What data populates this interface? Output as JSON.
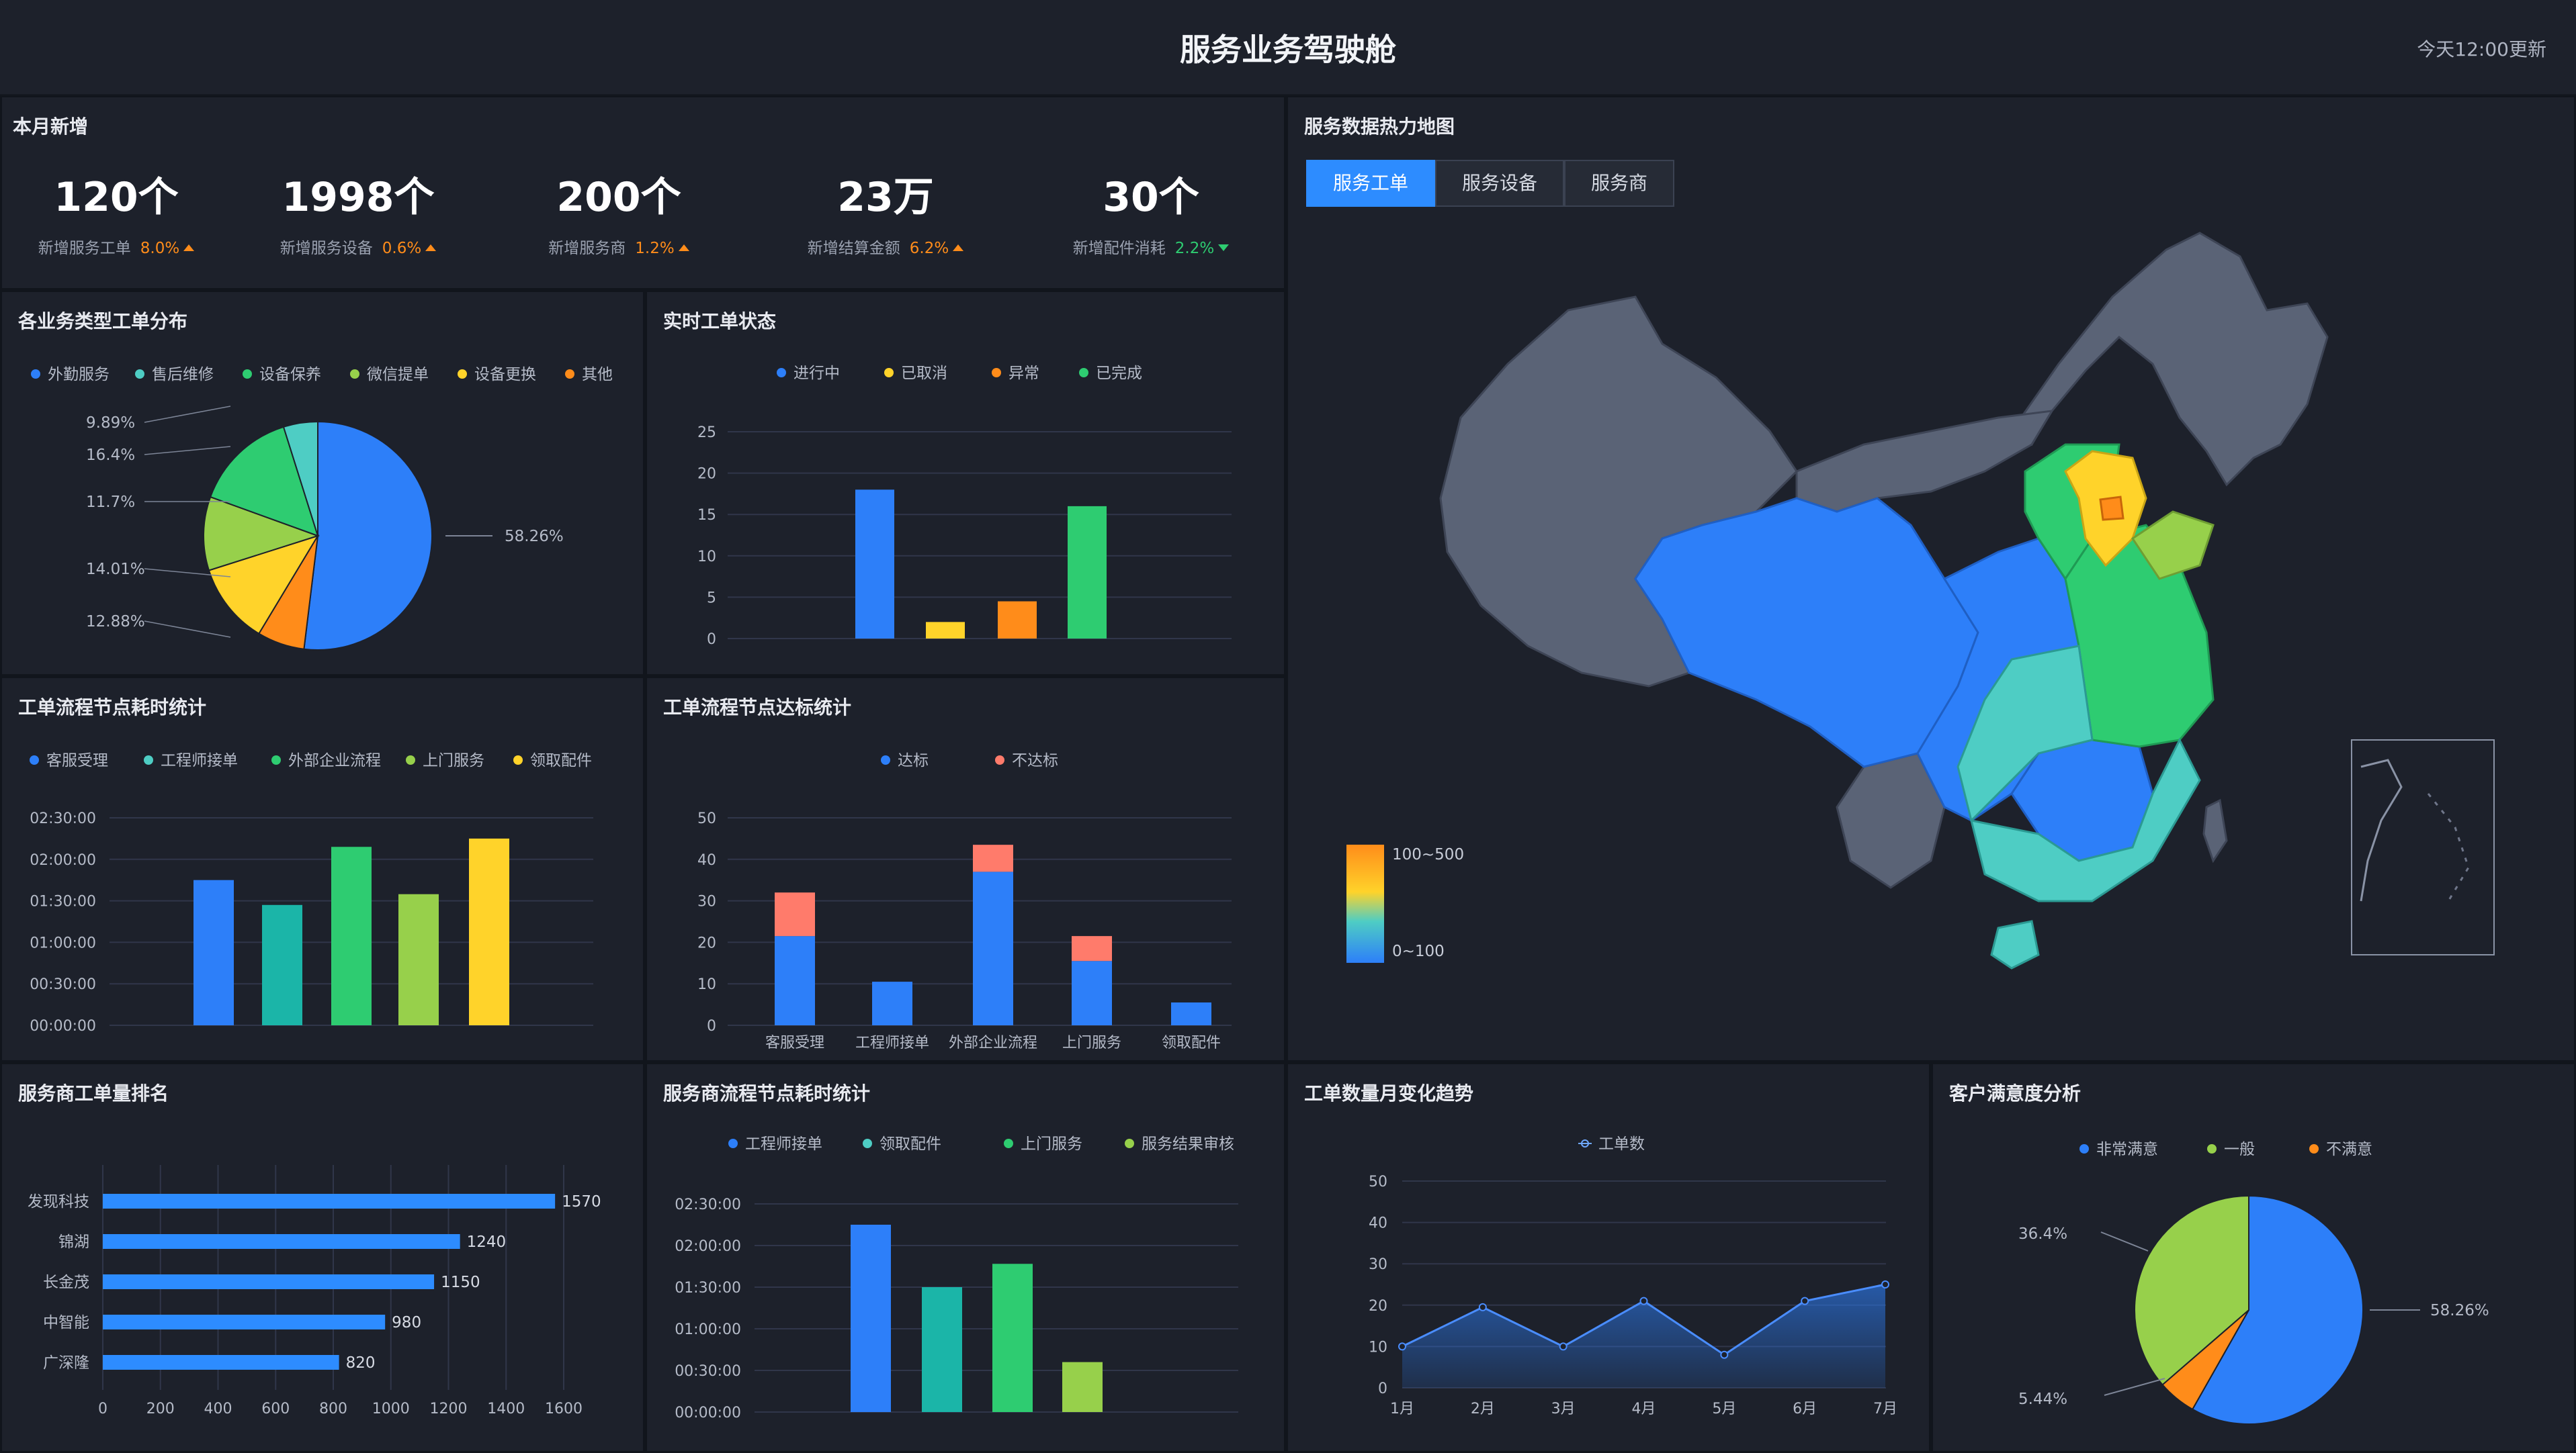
{
  "header": {
    "title": "服务业务驾驶舱",
    "update": "今天12:00更新"
  },
  "kpi_panel": {
    "title": "本月新增"
  },
  "kpis": [
    {
      "value": "120个",
      "label": "新增服务工单",
      "pct": "8.0%",
      "dir": "up"
    },
    {
      "value": "1998个",
      "label": "新增服务设备",
      "pct": "0.6%",
      "dir": "up"
    },
    {
      "value": "200个",
      "label": "新增服务商",
      "pct": "1.2%",
      "dir": "up"
    },
    {
      "value": "23万",
      "label": "新增结算金额",
      "pct": "6.2%",
      "dir": "up"
    },
    {
      "value": "30个",
      "label": "新增配件消耗",
      "pct": "2.2%",
      "dir": "down"
    }
  ],
  "map_panel": {
    "title": "服务数据热力地图",
    "tabs": [
      "服务工单",
      "服务设备",
      "服务商"
    ],
    "legend_high": "100~500",
    "legend_low": "0~100"
  },
  "colors": {
    "blue": "#2d7ff9",
    "teal": "#4ecdc4",
    "green": "#2ecc71",
    "lime": "#97d04b",
    "yellow": "#ffd32a",
    "orange": "#ff8c1a",
    "salmon": "#ff7b6b",
    "teal2": "#1bb5a8",
    "gray": "#5a6376"
  },
  "chart_data": [
    {
      "id": "type_dist",
      "type": "pie",
      "title": "各业务类型工单分布",
      "legend": [
        "外勤服务",
        "售后维修",
        "设备保养",
        "微信提单",
        "设备更换",
        "其他"
      ],
      "values": [
        58.26,
        5.44,
        12.88,
        14.01,
        11.7,
        9.89,
        16.4
      ],
      "labels": [
        "58.26%",
        "9.89%",
        "16.4%",
        "11.7%",
        "14.01%",
        "12.88%"
      ]
    },
    {
      "id": "realtime",
      "type": "bar",
      "title": "实时工单状态",
      "legend": [
        "进行中",
        "已取消",
        "异常",
        "已完成"
      ],
      "values": [
        18,
        2,
        4.5,
        16
      ],
      "ylim": [
        0,
        25
      ],
      "yticks": [
        "0",
        "5",
        "10",
        "15",
        "20",
        "25"
      ]
    },
    {
      "id": "node_time",
      "type": "bar",
      "title": "工单流程节点耗时统计",
      "legend": [
        "客服受理",
        "工程师接单",
        "外部企业流程",
        "上门服务",
        "领取配件"
      ],
      "values": [
        1.75,
        1.45,
        2.15,
        1.58,
        2.25
      ],
      "ylim": [
        0,
        2.5
      ],
      "yticks": [
        "00:00:00",
        "00:30:00",
        "01:00:00",
        "01:30:00",
        "02:00:00",
        "02:30:00"
      ]
    },
    {
      "id": "node_std",
      "type": "bar",
      "title": "工单流程节点达标统计",
      "legend": [
        "达标",
        "不达标"
      ],
      "categories": [
        "客服受理",
        "工程师接单",
        "外部企业流程",
        "上门服务",
        "领取配件"
      ],
      "series": [
        {
          "name": "达标",
          "values": [
            21.5,
            10.5,
            37,
            15.5,
            5.5
          ]
        },
        {
          "name": "不达标",
          "values": [
            10.5,
            0,
            6.5,
            6,
            0
          ]
        }
      ],
      "ylim": [
        0,
        50
      ],
      "yticks": [
        "0",
        "10",
        "20",
        "30",
        "40",
        "50"
      ]
    },
    {
      "id": "provider_rank",
      "type": "bar",
      "title": "服务商工单量排名",
      "categories": [
        "发现科技",
        "锦湖",
        "长金茂",
        "中智能",
        "广深隆"
      ],
      "values": [
        1570,
        1240,
        1150,
        980,
        820
      ],
      "value_labels": [
        "1570",
        "1240",
        "1150",
        "980",
        "820"
      ],
      "xlim": [
        0,
        1600
      ],
      "xticks": [
        "0",
        "200",
        "400",
        "600",
        "800",
        "1000",
        "1200",
        "1400",
        "1600"
      ]
    },
    {
      "id": "provider_time",
      "type": "bar",
      "title": "服务商流程节点耗时统计",
      "legend": [
        "工程师接单",
        "领取配件",
        "上门服务",
        "服务结果审核"
      ],
      "values": [
        2.25,
        1.5,
        1.78,
        0.6
      ],
      "ylim": [
        0,
        2.5
      ],
      "yticks": [
        "00:00:00",
        "00:30:00",
        "01:00:00",
        "01:30:00",
        "02:00:00",
        "02:30:00"
      ]
    },
    {
      "id": "monthly",
      "type": "area",
      "title": "工单数量月变化趋势",
      "legend": [
        "工单数"
      ],
      "x": [
        "1月",
        "2月",
        "3月",
        "4月",
        "5月",
        "6月",
        "7月"
      ],
      "values": [
        10,
        19.5,
        10,
        21,
        8,
        21,
        25
      ],
      "ylim": [
        0,
        50
      ],
      "yticks": [
        "0",
        "10",
        "20",
        "30",
        "40",
        "50"
      ]
    },
    {
      "id": "satisfaction",
      "type": "pie",
      "title": "客户满意度分析",
      "legend": [
        "非常满意",
        "一般",
        "不满意"
      ],
      "values": [
        58.26,
        36.4,
        5.44
      ],
      "labels": [
        "58.26%",
        "36.4%",
        "5.44%"
      ]
    }
  ]
}
